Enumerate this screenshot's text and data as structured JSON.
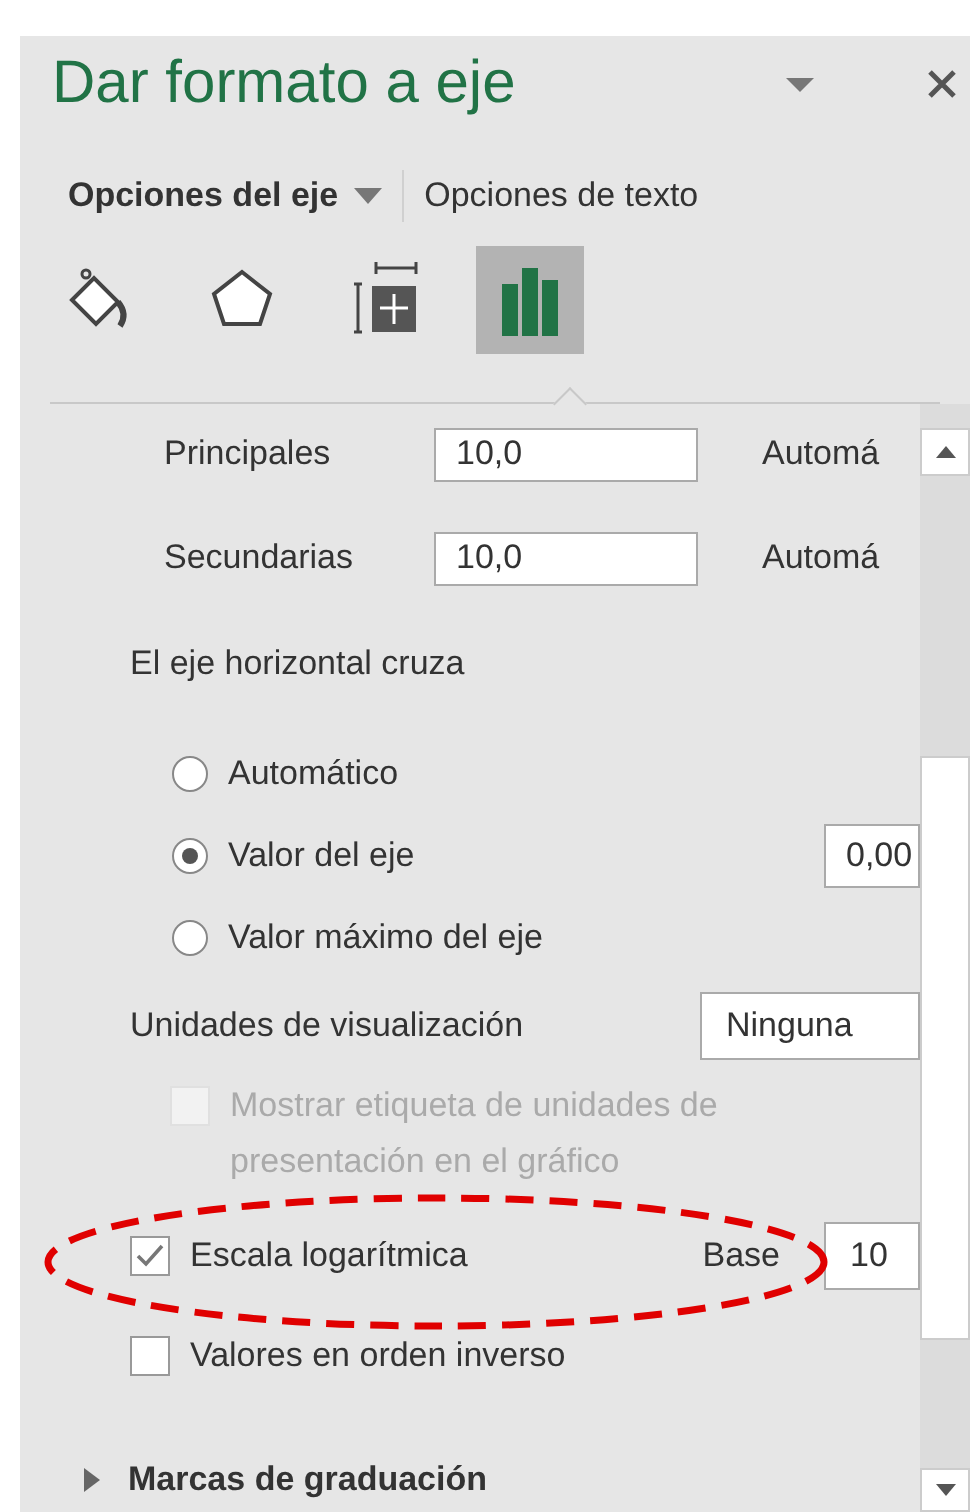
{
  "panel": {
    "title": "Dar formato a eje"
  },
  "tabs": [
    {
      "label": "Opciones del eje",
      "selected": true
    },
    {
      "label": "Opciones de texto",
      "selected": false
    }
  ],
  "icon_tabs": [
    {
      "kind": "fill",
      "selected": false
    },
    {
      "kind": "effects",
      "selected": false
    },
    {
      "kind": "size",
      "selected": false
    },
    {
      "kind": "axis",
      "selected": true
    }
  ],
  "units": [
    {
      "label": "Principales",
      "value": "10,0",
      "mode": "Automá"
    },
    {
      "label": "Secundarias",
      "value": "10,0",
      "mode": "Automá"
    }
  ],
  "crosses": {
    "heading": "El eje horizontal cruza",
    "options": [
      {
        "label": "Automático",
        "selected": false
      },
      {
        "label": "Valor del eje",
        "selected": true,
        "value": "0,00"
      },
      {
        "label": "Valor máximo del eje",
        "selected": false
      }
    ]
  },
  "display_units": {
    "label": "Unidades de visualización",
    "value": "Ninguna"
  },
  "checks": [
    {
      "kind": "disabled",
      "label": "Mostrar etiqueta de unidades de presentación en el gráfico",
      "checked": false,
      "disabled": true
    },
    {
      "kind": "log",
      "label": "Escala logarítmica",
      "checked": true,
      "base_label": "Base",
      "base_value": "10"
    },
    {
      "kind": "plain",
      "label": "Valores en orden inverso",
      "checked": false
    }
  ],
  "sections": [
    {
      "label": "Marcas de graduación",
      "expanded": false
    }
  ],
  "annotation": {
    "kind": "ellipse"
  }
}
